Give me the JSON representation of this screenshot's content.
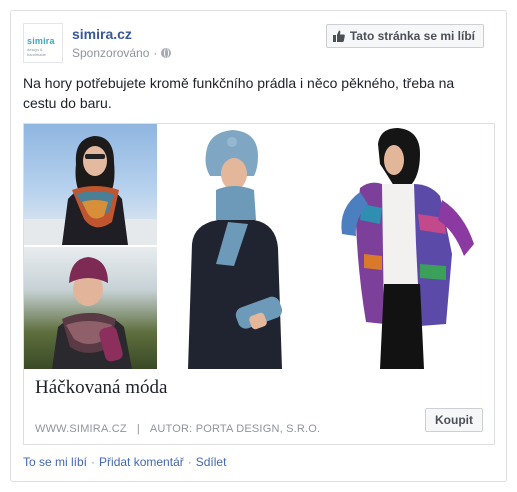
{
  "post": {
    "page_name": "simira.cz",
    "sponsored_label": "Sponzorováno",
    "privacy_icon": "globe-icon",
    "like_page_label": "Tato stránka se mi líbí",
    "logo": {
      "word": "simira",
      "sub": "design & handmade"
    },
    "text": "Na hory potřebujete kromě funkčního prádla i něco pěkného, třeba na cestu do baru."
  },
  "attachment": {
    "title": "Háčkovaná móda",
    "domain": "WWW.SIMIRA.CZ",
    "separator": "|",
    "author": "AUTOR: PORTA DESIGN, S.R.O.",
    "cta_label": "Koupit"
  },
  "actions": {
    "like": "To se mi líbí",
    "comment": "Přidat komentář",
    "share": "Sdílet",
    "dot": "·"
  },
  "colors": {
    "link": "#365899",
    "muted": "#90949c",
    "border": "#dddfe2"
  }
}
